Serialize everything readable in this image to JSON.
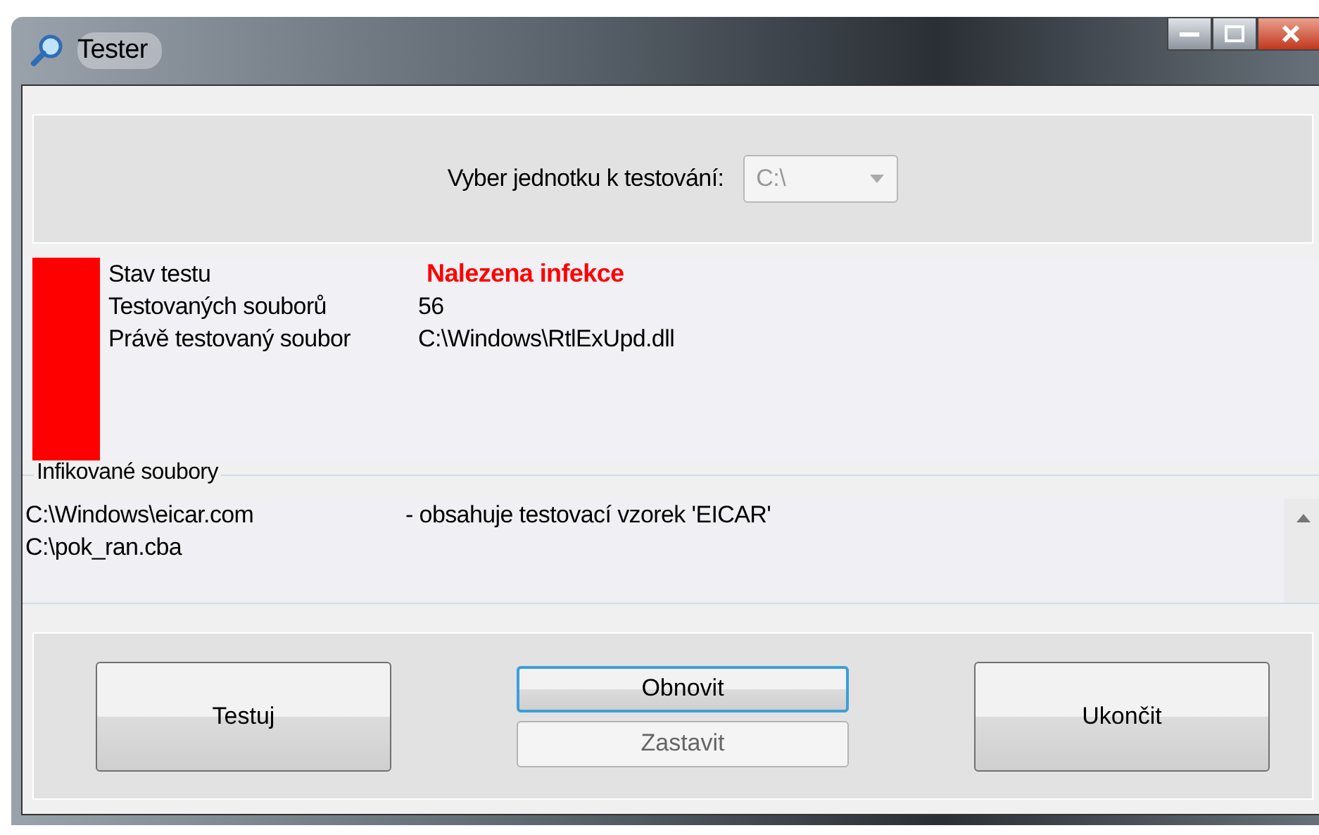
{
  "window": {
    "title": "Tester"
  },
  "drive": {
    "label": "Vyber jednotku k testování:",
    "value": "C:\\",
    "disabled": true
  },
  "status": {
    "color": "#ff0000",
    "rows": [
      {
        "label": "Stav testu",
        "value": "Nalezena infekce",
        "kind": "alert"
      },
      {
        "label": "Testovaných souborů",
        "value": "56",
        "kind": "plain"
      },
      {
        "label": "Právě testovaný soubor",
        "value": "C:\\Windows\\RtlExUpd.dll",
        "kind": "plain"
      }
    ]
  },
  "infected": {
    "title": "Infikované soubory",
    "rows": [
      {
        "file": "C:\\Windows\\eicar.com",
        "note": "- obsahuje testovací vzorek 'EICAR'"
      },
      {
        "file": "C:\\pok_ran.cba"
      }
    ]
  },
  "buttons": [
    {
      "label": "Testuj",
      "kind": "big",
      "disabled": false,
      "default": false
    },
    {
      "label": "Obnovit",
      "kind": "small",
      "disabled": false,
      "default": true
    },
    {
      "label": "Zastavit",
      "kind": "small",
      "disabled": true,
      "default": false
    },
    {
      "label": "Ukončit",
      "kind": "big",
      "disabled": false,
      "default": false
    }
  ]
}
